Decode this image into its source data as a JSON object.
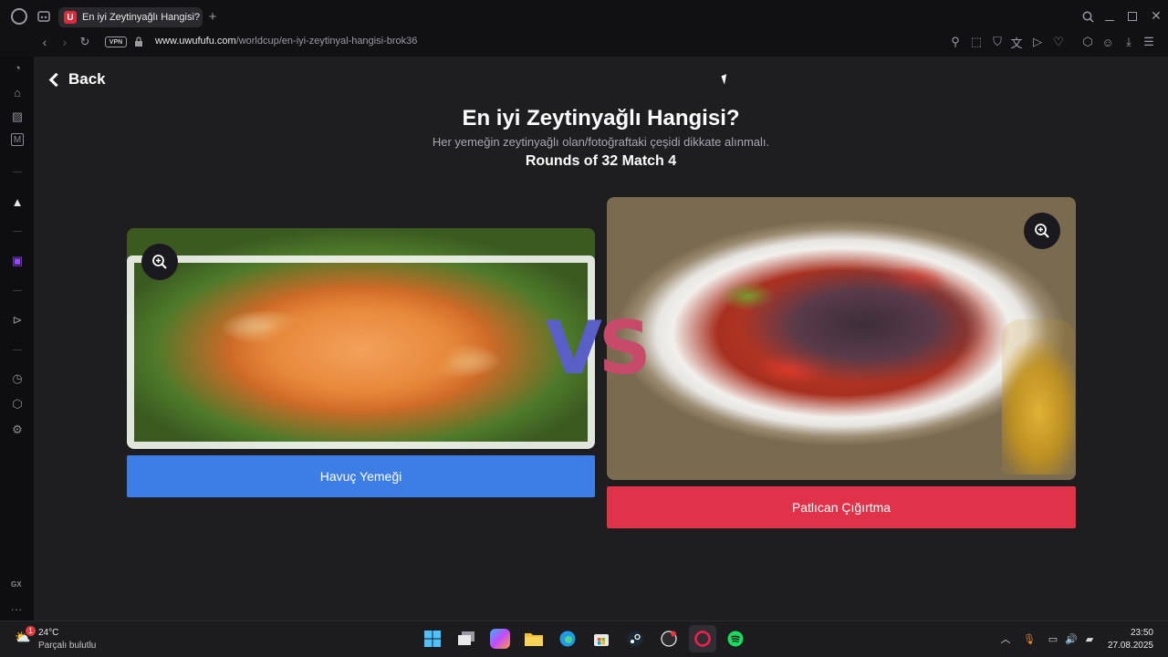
{
  "browser": {
    "tab_title": "En iyi Zeytinyağlı Hangisi?",
    "tab_favicon": "U",
    "vpn_label": "VPN",
    "url_domain": "www.uwufufu.com",
    "url_path": "/worldcup/en-iyi-zeytinyal-hangisi-brok36"
  },
  "page": {
    "back_label": "Back",
    "title": "En iyi Zeytinyağlı Hangisi?",
    "subtitle": "Her yemeğin zeytinyağlı olan/fotoğraftaki çeşidi dikkate alınmalı.",
    "round_info": "Rounds of 32 Match 4",
    "vs_v": "V",
    "vs_s": "S",
    "left_choice": {
      "label": "Havuç Yemeği",
      "color": "#3d7ee6"
    },
    "right_choice": {
      "label": "Patlıcan Çığırtma",
      "color": "#e0334a"
    }
  },
  "sidebar": {
    "label_gx": "GX",
    "more": "..."
  },
  "taskbar": {
    "weather_temp": "24°C",
    "weather_desc": "Parçalı bulutlu",
    "weather_badge": "1",
    "time": "23:50",
    "date": "27.08.2025"
  }
}
